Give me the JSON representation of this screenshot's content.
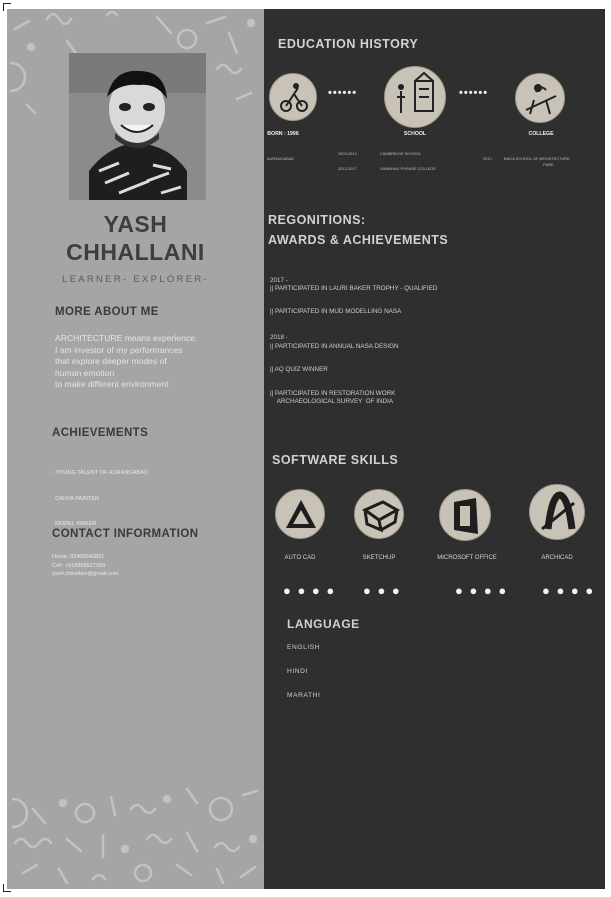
{
  "profile": {
    "first_name": "YASH",
    "last_name": "CHHALLANI",
    "tagline": "LEARNER- EXPLORER-"
  },
  "about": {
    "title": "MORE ABOUT ME",
    "lines": [
      "ARCHITECTURE  means experience,",
      "I am investor of my performances",
      "that explore deeper modes of",
      "human emotion",
      "to make different environment"
    ]
  },
  "left_achievements": {
    "title": "ACHIEVEMENTS",
    "items": [
      "- YOUNG TALENT OF AURANGABAD",
      "  CANVA PAINTER",
      "  MODEL MAKER"
    ]
  },
  "contact": {
    "title": "CONTACT INFORMATION",
    "home": "Home: 02406542891",
    "cell": "Cell: +918888527089",
    "email": "yash.chhallani@gmail.com"
  },
  "education": {
    "title": "EDUCATION HISTORY",
    "nodes": [
      {
        "label": "BORN : 1996",
        "icon": "bicycle-sketch-icon"
      },
      {
        "label": "SCHOOL",
        "icon": "school-sketch-icon"
      },
      {
        "label": "COLLEGE",
        "icon": "drafting-sketch-icon"
      }
    ],
    "born_place": "AURANGABAD",
    "school_year_1": "2003-2013",
    "school_name_1": "CAMBRIDGE SCHOOL",
    "school_year_2": "2013-2017",
    "school_name_2": "SAMBHAJI PURASE COLLEGE",
    "college_year": "2017-",
    "college_name_1": "BNCA  SCHOOL OF ARCHITECTURE",
    "college_name_2": "PUNE"
  },
  "awards": {
    "title_1": "REGONITIONS:",
    "title_2": "AWARDS & ACHIEVEMENTS",
    "lines": [
      "2017 -",
      "|| PARTICIPATED IN LAURI BAKER TROPHY - QUALIFIED",
      "|| PARTICIPATED IN  MUD MODELLING NASA",
      "2018 -",
      "|| PARTICIPATED IN ANNUAL NASA DESIGN",
      "|| AQ QUIZ WINNER",
      "|| PARTICIPATED IN RESTORATION WORK",
      "    ARCHAEOLOGICAL SURVEY  OF INDIA"
    ]
  },
  "software": {
    "title": "SOFTWARE SKILLS",
    "items": [
      {
        "label": "AUTO CAD",
        "icon": "autocad-sketch-icon",
        "rating": "● ● ● ●",
        "dots": 4
      },
      {
        "label": "SKETCHUP",
        "icon": "sketchup-sketch-icon",
        "rating": "● ● ●",
        "dots": 3
      },
      {
        "label": "MICROSOFT OFFICE",
        "icon": "office-sketch-icon",
        "rating": "● ● ● ●",
        "dots": 4
      },
      {
        "label": "ARCHICAD",
        "icon": "archicad-sketch-icon",
        "rating": "● ● ● ●",
        "dots": 4
      }
    ]
  },
  "language": {
    "title": "LANGUAGE",
    "items": [
      "ENGLISH",
      "HINDI",
      "MARATHI"
    ]
  },
  "colors": {
    "dark_panel": "#2f2f2f",
    "grey_panel": "#a5a5a5",
    "heading_dark": "#3e3e3e",
    "heading_light": "#d2d2d2"
  }
}
